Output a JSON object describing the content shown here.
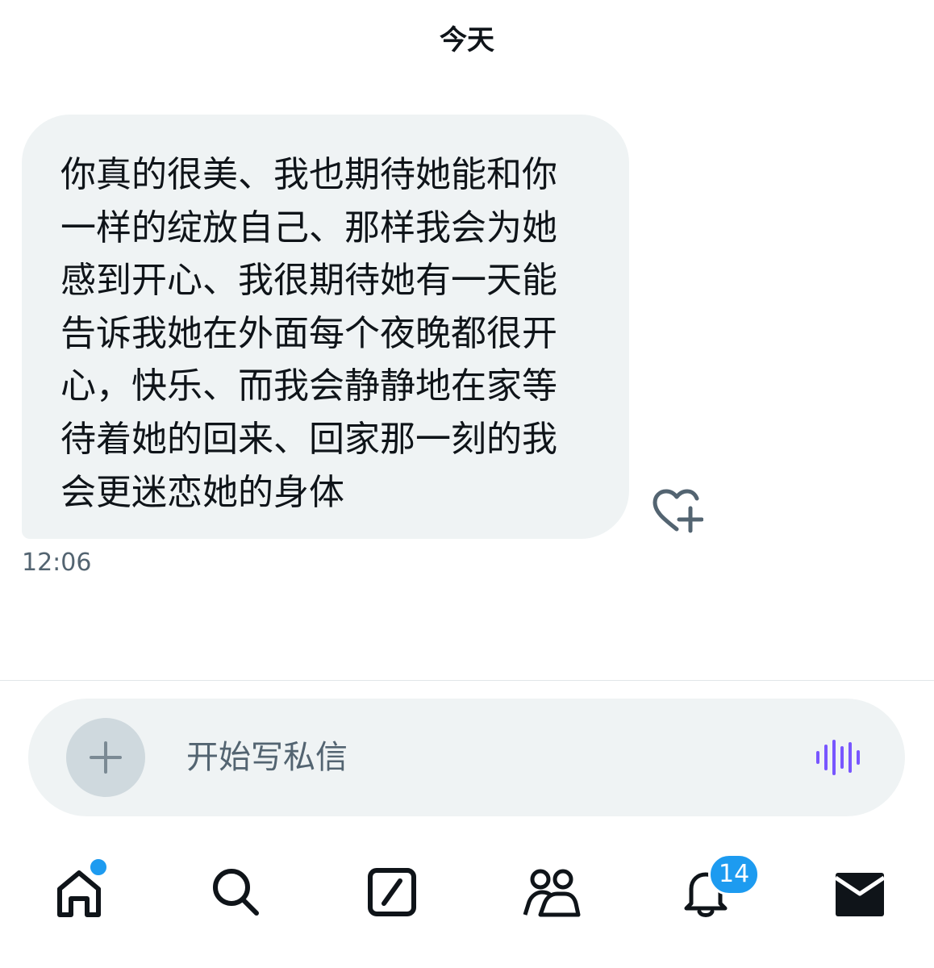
{
  "conversation": {
    "date_label": "今天",
    "messages": [
      {
        "text": "你真的很美、我也期待她能和你\n一样的绽放自己、那样我会为她\n感到开心、我很期待她有一天能\n告诉我她在外面每个夜晚都很开\n心，快乐、而我会静静地在家等\n待着她的回来、回家那一刻的我\n会更迷恋她的身体",
        "time": "12:06",
        "react_icon": "heart-plus-icon"
      }
    ]
  },
  "composer": {
    "placeholder": "开始写私信",
    "value": "",
    "add_icon": "plus-icon",
    "voice_icon": "voice-waveform-icon"
  },
  "bottom_nav": {
    "items": [
      {
        "id": "home",
        "icon": "home-icon",
        "has_dot": true
      },
      {
        "id": "search",
        "icon": "search-icon"
      },
      {
        "id": "grok",
        "icon": "grok-icon"
      },
      {
        "id": "communities",
        "icon": "people-icon"
      },
      {
        "id": "notifications",
        "icon": "bell-icon",
        "badge": "14"
      },
      {
        "id": "messages",
        "icon": "envelope-icon",
        "active": true
      }
    ]
  },
  "colors": {
    "bubble_bg": "#eff3f4",
    "accent": "#1d9bf0",
    "voice_accent": "#7856ff",
    "secondary_text": "#536471"
  }
}
